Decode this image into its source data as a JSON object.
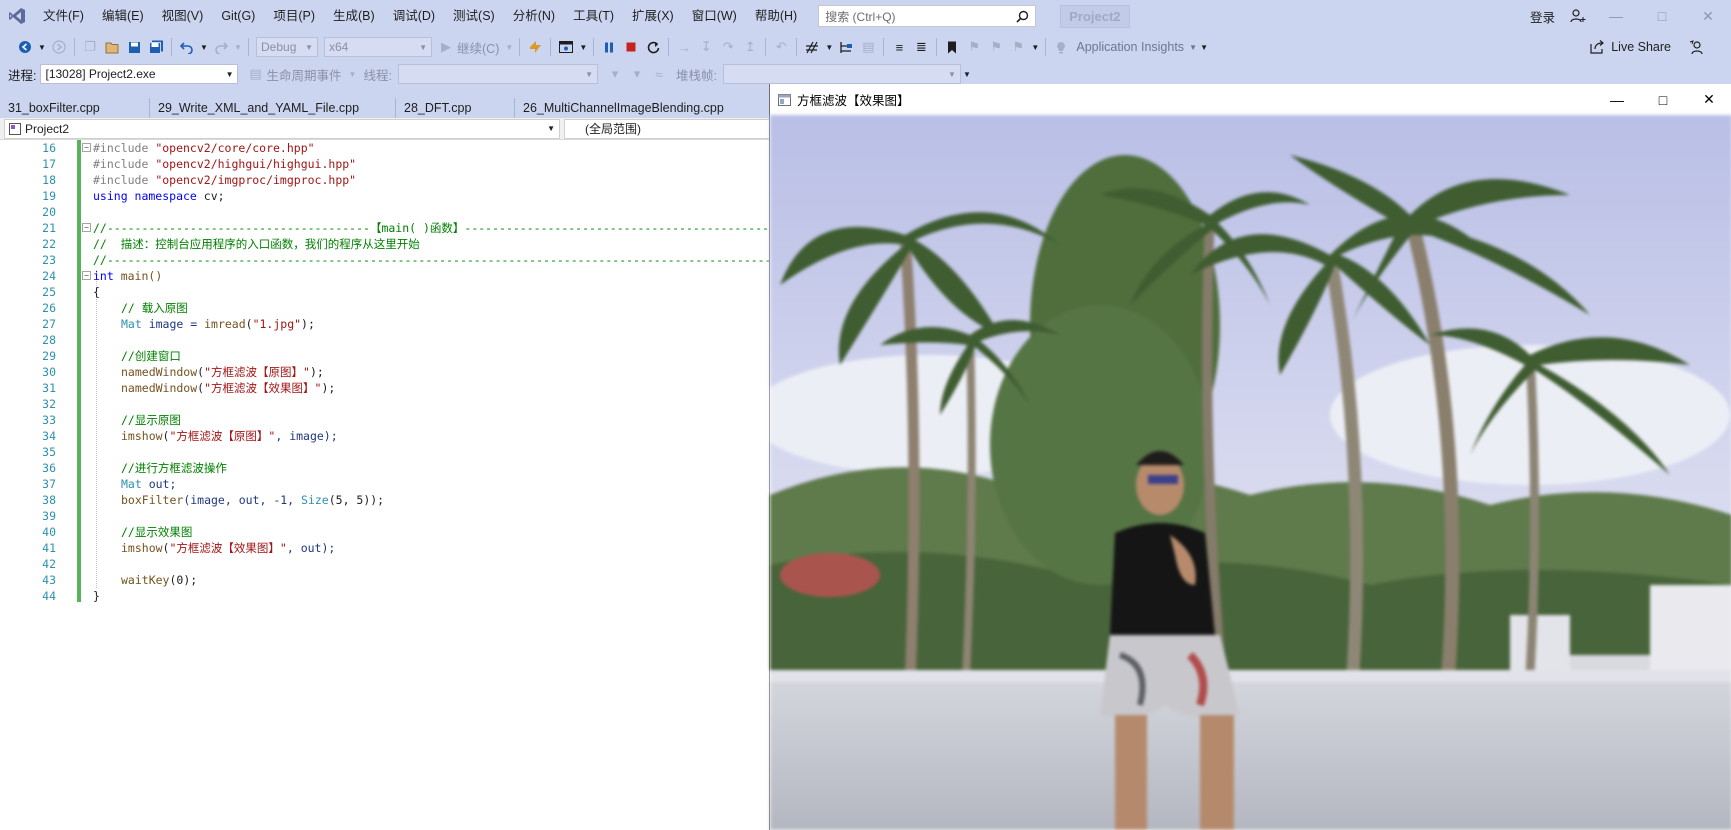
{
  "menubar": {
    "items": [
      "文件(F)",
      "编辑(E)",
      "视图(V)",
      "Git(G)",
      "项目(P)",
      "生成(B)",
      "调试(D)",
      "测试(S)",
      "分析(N)",
      "工具(T)",
      "扩展(X)",
      "窗口(W)",
      "帮助(H)"
    ],
    "search_placeholder": "搜索 (Ctrl+Q)",
    "project_name": "Project2",
    "login": "登录"
  },
  "toolbar": {
    "config": "Debug",
    "platform": "x64",
    "continue_label": "继续(C)",
    "app_insights": "Application Insights",
    "live_share": "Live Share"
  },
  "toolbar2": {
    "process_label": "进程:",
    "process_value": "[13028] Project2.exe",
    "lifecycle_label": "生命周期事件",
    "thread_label": "线程:",
    "stackframe_label": "堆栈帧:"
  },
  "tabs": [
    "31_boxFilter.cpp",
    "29_Write_XML_and_YAML_File.cpp",
    "28_DFT.cpp",
    "26_MultiChannelImageBlending.cpp"
  ],
  "navbar": {
    "project": "Project2",
    "scope": "(全局范围)"
  },
  "code": {
    "line_numbers": [
      "16",
      "17",
      "18",
      "19",
      "20",
      "21",
      "22",
      "23",
      "24",
      "25",
      "26",
      "27",
      "28",
      "29",
      "30",
      "31",
      "32",
      "33",
      "34",
      "35",
      "36",
      "37",
      "38",
      "39",
      "40",
      "41",
      "42",
      "43",
      "44"
    ],
    "inc1": "#include ",
    "inc1_path": "\"opencv2/core/core.hpp\"",
    "inc2": "#include ",
    "inc2_path": "\"opencv2/highgui/highgui.hpp\"",
    "inc3": "#include ",
    "inc3_path": "\"opencv2/imgproc/imgproc.hpp\"",
    "using_kw": "using namespace",
    "using_ns": " cv;",
    "banner1": "//--------------------------------------【main( )函数】-----------------------------------------------",
    "banner2": "//  描述：控制台应用程序的入口函数，我们的程序从这里开始",
    "banner3": "//-----------------------------------------------------------------------------------------------------",
    "int_kw": "int",
    "main_sig": " main()",
    "brace_open": "{",
    "c_load": "// 载入原图",
    "mat": "Mat",
    "image_decl": " image = ",
    "imread": "imread",
    "imread_arg_open": "(",
    "imread_str": "\"1.jpg\"",
    "imread_close": ");",
    "c_window": "//创建窗口",
    "namedWindow": "namedWindow",
    "nw1_str": "\"方框滤波【原图】\"",
    "nw2_str": "\"方框滤波【效果图】\"",
    "call_close": ");",
    "c_show_src": "//显示原图",
    "imshow": "imshow",
    "is1_str": "\"方框滤波【原图】\"",
    "is1_rest": ", image);",
    "c_filter": "//进行方框滤波操作",
    "mat2": "Mat",
    "out_decl": " out;",
    "boxFilter": "boxFilter",
    "bf_args1": "(image, out, -1, ",
    "size": "Size",
    "bf_args2": "(5, 5));",
    "c_show_dst": "//显示效果图",
    "imshow2": "imshow",
    "is2_str": "\"方框滤波【效果图】\"",
    "is2_rest": ", out);",
    "waitKey": "waitKey",
    "wk_args": "(0);",
    "brace_close": "}"
  },
  "image_window": {
    "title": "方框滤波【效果图】"
  }
}
